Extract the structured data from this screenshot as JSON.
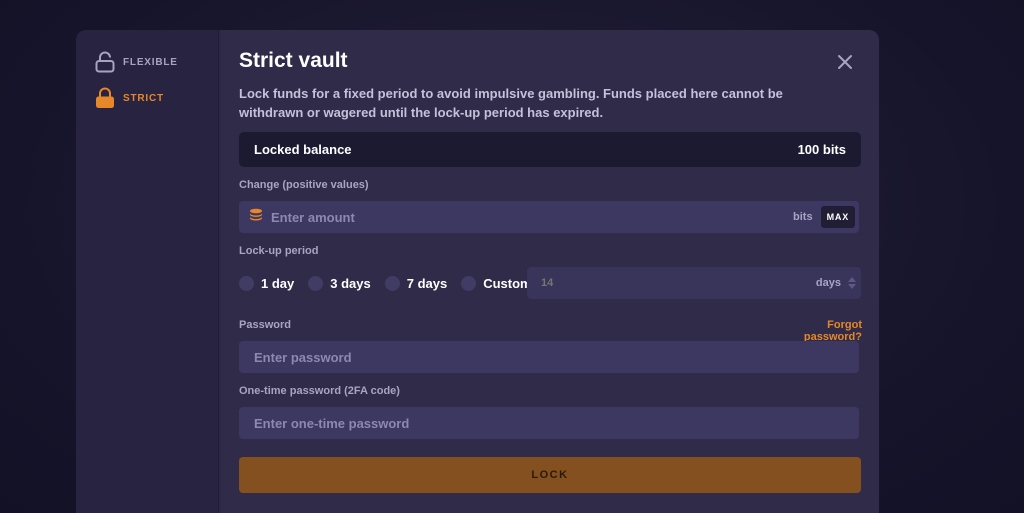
{
  "colors": {
    "accent": "#e6872a",
    "lock_button": "#84501f",
    "panel": "#2f2b48",
    "sidebar": "#272340",
    "input": "#3d3862"
  },
  "sidebar": {
    "items": [
      {
        "label": "FLEXIBLE",
        "icon": "unlock-icon",
        "active": false
      },
      {
        "label": "STRICT",
        "icon": "lock-icon",
        "active": true
      }
    ]
  },
  "vault": {
    "title": "Strict vault",
    "description": "Lock funds for a fixed period to avoid impulsive gambling. Funds placed here cannot be withdrawn or wagered until the lock-up period has expired.",
    "balance_label": "Locked balance",
    "balance_value": "100 bits"
  },
  "change": {
    "label": "Change (positive values)",
    "placeholder": "Enter amount",
    "unit": "bits",
    "max_label": "MAX"
  },
  "lockup": {
    "label": "Lock-up period",
    "options": [
      "1 day",
      "3 days",
      "7 days",
      "Custom"
    ],
    "custom_placeholder": "14",
    "custom_unit": "days"
  },
  "password": {
    "label": "Password",
    "placeholder": "Enter password",
    "forgot_label": "Forgot password?"
  },
  "otp": {
    "label": "One-time password (2FA code)",
    "placeholder": "Enter one-time password"
  },
  "action": {
    "lock_label": "LOCK"
  }
}
